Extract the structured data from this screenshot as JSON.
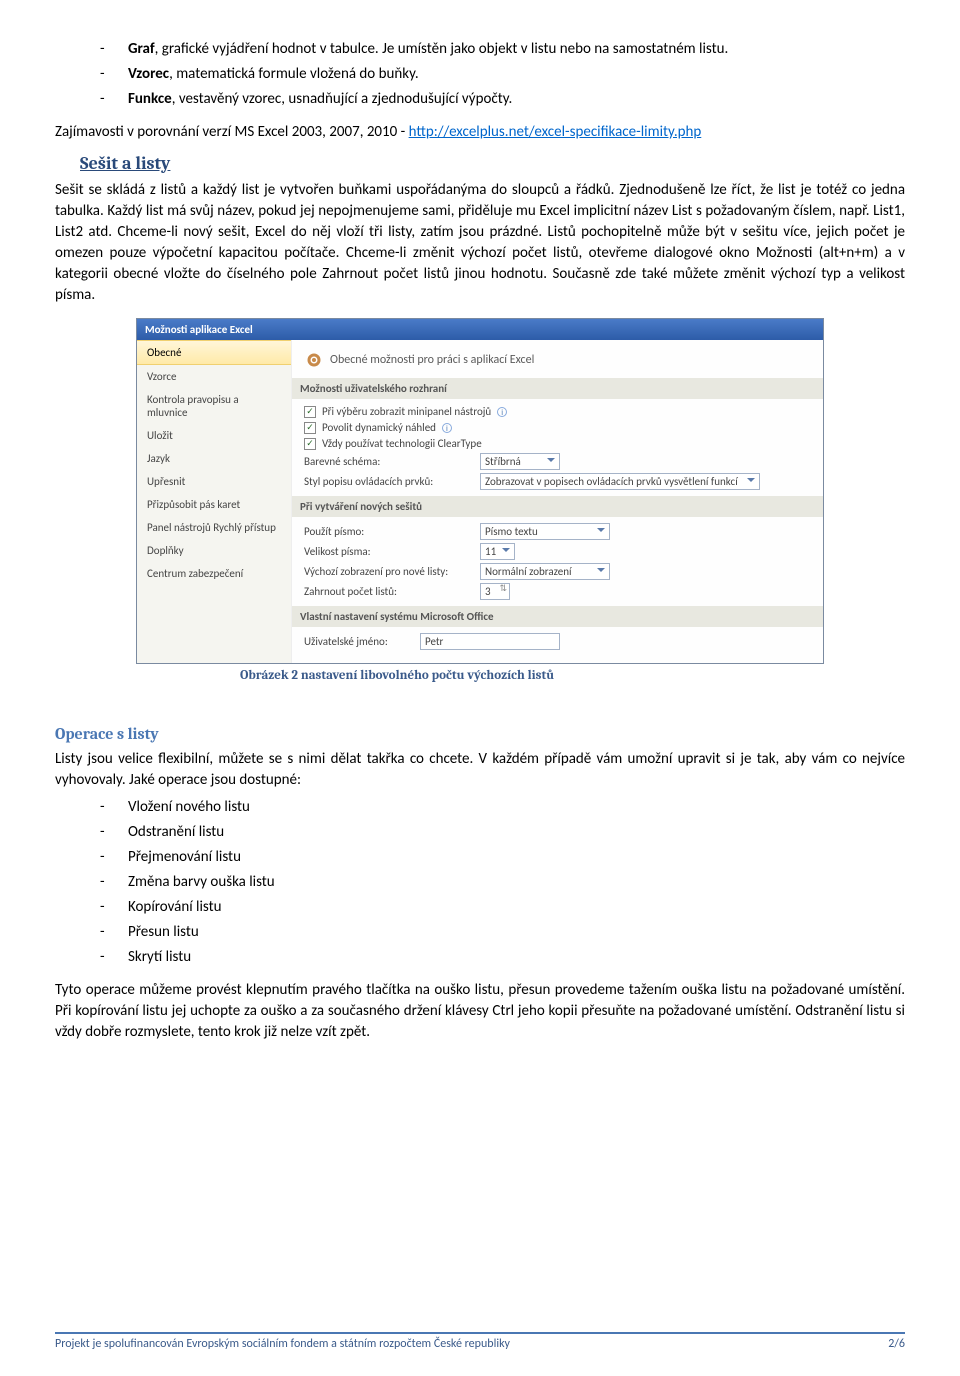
{
  "top_bullets": {
    "b1_bold": "Graf",
    "b1_rest": ", grafické vyjádření hodnot v tabulce. Je umístěn jako objekt v listu nebo na samostatném listu.",
    "b2_bold": "Vzorec",
    "b2_rest": ", matematická formule vložená do buňky.",
    "b3_bold": "Funkce",
    "b3_rest": ", vestavěný vzorec, usnadňující a zjednodušující výpočty."
  },
  "link_para_pre": "Zajímavosti v porovnání verzí MS Excel 2003, 2007, 2010 - ",
  "link_text": "http://excelplus.net/excel-specifikace-limity.php",
  "h2_sesit": "Sešit a listy",
  "para_sesit": "Sešit se skládá z listů a každý list je vytvořen buňkami uspořádanýma do sloupců a řádků. Zjednodušeně lze říct, že list je totéž co jedna tabulka. Každý list má svůj název, pokud jej nepojmenujeme sami, přiděluje mu Excel implicitní název List s požadovaným číslem, např. List1, List2 atd. Chceme-li nový sešit, Excel do něj vloží tři listy, zatím jsou prázdné. Listů pochopitelně může být v sešitu více, jejich počet je omezen pouze výpočetní kapacitou počítače. Chceme-li změnit výchozí počet listů, otevřeme dialogové okno Možnosti (alt+n+m) a v kategorii obecné vložte do číselného pole Zahrnout počet listů jinou hodnotu. Současně zde také můžete změnit výchozí typ a velikost písma.",
  "dialog": {
    "title": "Možnosti aplikace Excel",
    "sidebar": [
      "Obecné",
      "Vzorce",
      "Kontrola pravopisu a mluvnice",
      "Uložit",
      "Jazyk",
      "Upřesnit",
      "Přizpůsobit pás karet",
      "Panel nástrojů Rychlý přístup",
      "Doplňky",
      "Centrum zabezpečení"
    ],
    "main_header": "Obecné možnosti pro práci s aplikací Excel",
    "section1": "Možnosti uživatelského rozhraní",
    "chk1": "Při výběru zobrazit minipanel nástrojů",
    "chk2": "Povolit dynamický náhled",
    "chk3": "Vždy používat technologii ClearType",
    "row_scheme_lbl": "Barevné schéma:",
    "row_scheme_val": "Stříbrná",
    "row_style_lbl": "Styl popisu ovládacích prvků:",
    "row_style_val": "Zobrazovat v popisech ovládacích prvků vysvětlení funkcí",
    "section2": "Při vytváření nových sešitů",
    "row_font_lbl": "Použít písmo:",
    "row_font_val": "Písmo textu",
    "row_size_lbl": "Velikost písma:",
    "row_size_val": "11",
    "row_view_lbl": "Výchozí zobrazení pro nové listy:",
    "row_view_val": "Normální zobrazení",
    "row_count_lbl": "Zahrnout počet listů:",
    "row_count_val": "3",
    "section3": "Vlastní nastavení systému Microsoft Office",
    "row_user_lbl": "Uživatelské jméno:",
    "row_user_val": "Petr"
  },
  "caption": "Obrázek 2 nastavení libovolného počtu výchozích listů",
  "h3_operace": "Operace s listy",
  "para_operace_intro": "Listy jsou velice flexibilní, můžete se s nimi dělat takřka co chcete. V každém případě vám umožní upravit si je tak, aby vám co nejvíce vyhovovaly. Jaké operace jsou dostupné:",
  "op_bullets": [
    "Vložení nového listu",
    "Odstranění listu",
    "Přejmenování listu",
    "Změna barvy ouška listu",
    "Kopírování listu",
    "Přesun listu",
    "Skrytí listu"
  ],
  "para_operace_end": "Tyto operace můžeme provést klepnutím pravého tlačítka na ouško listu, přesun provedeme tažením ouška listu na požadované umístění. Při kopírování listu jej uchopte za ouško a za současného držení klávesy Ctrl jeho kopii přesuňte na požadované umístění. Odstranění listu si vždy dobře rozmyslete, tento krok již nelze vzít zpět.",
  "footer_left": "Projekt je spolufinancován Evropským sociálním fondem a státním rozpočtem České republiky",
  "footer_right": "2/6"
}
